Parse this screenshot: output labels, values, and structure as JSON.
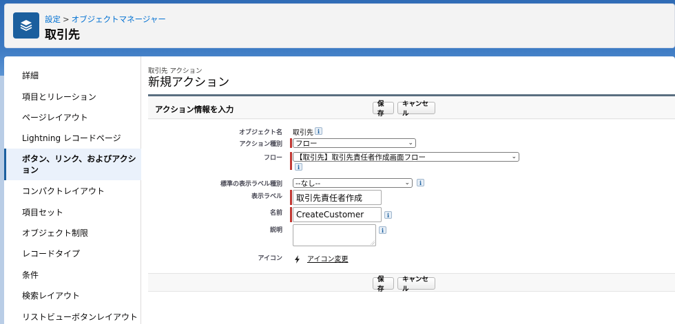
{
  "breadcrumb": {
    "settings": "設定",
    "separator": ">",
    "object_manager": "オブジェクトマネージャー"
  },
  "header": {
    "title": "取引先",
    "icon": "layers-icon"
  },
  "sidebar": {
    "items": [
      {
        "label": "詳細"
      },
      {
        "label": "項目とリレーション"
      },
      {
        "label": "ページレイアウト"
      },
      {
        "label": "Lightning レコードページ"
      },
      {
        "label": "ボタン、リンク、およびアクション",
        "line1": "ボタン、リンク、およびアクシ",
        "line2": "ョン",
        "active": true
      },
      {
        "label": "コンパクトレイアウト"
      },
      {
        "label": "項目セット"
      },
      {
        "label": "オブジェクト制限"
      },
      {
        "label": "レコードタイプ"
      },
      {
        "label": "条件"
      },
      {
        "label": "検索レイアウト"
      },
      {
        "label": "リストビューボタンレイアウト"
      }
    ]
  },
  "page": {
    "sub_label": "取引先 アクション",
    "title": "新規アクション"
  },
  "panel": {
    "title": "アクション情報を入力",
    "save_label": "保存",
    "cancel_label": "キャンセル"
  },
  "form": {
    "object_name_label": "オブジェクト名",
    "object_name_value": "取引先",
    "action_type_label": "アクション種別",
    "action_type_value": "フロー",
    "flow_label": "フロー",
    "flow_value": "【取引先】取引先責任者作成画面フロー",
    "std_label_type_label": "標準の表示ラベル種別",
    "std_label_type_value": "--なし--",
    "display_label_label": "表示ラベル",
    "display_label_value": "取引先責任者作成",
    "name_label": "名前",
    "name_value": "CreateCustomer",
    "description_label": "説明",
    "description_value": "",
    "icon_label": "アイコン",
    "icon_change_link": "アイコン変更",
    "icon_glyph": "lightning-icon"
  },
  "info_icon_glyph": "i",
  "colors": {
    "accent": "#1b5f9e",
    "link": "#0070d2",
    "required": "#c23934"
  }
}
